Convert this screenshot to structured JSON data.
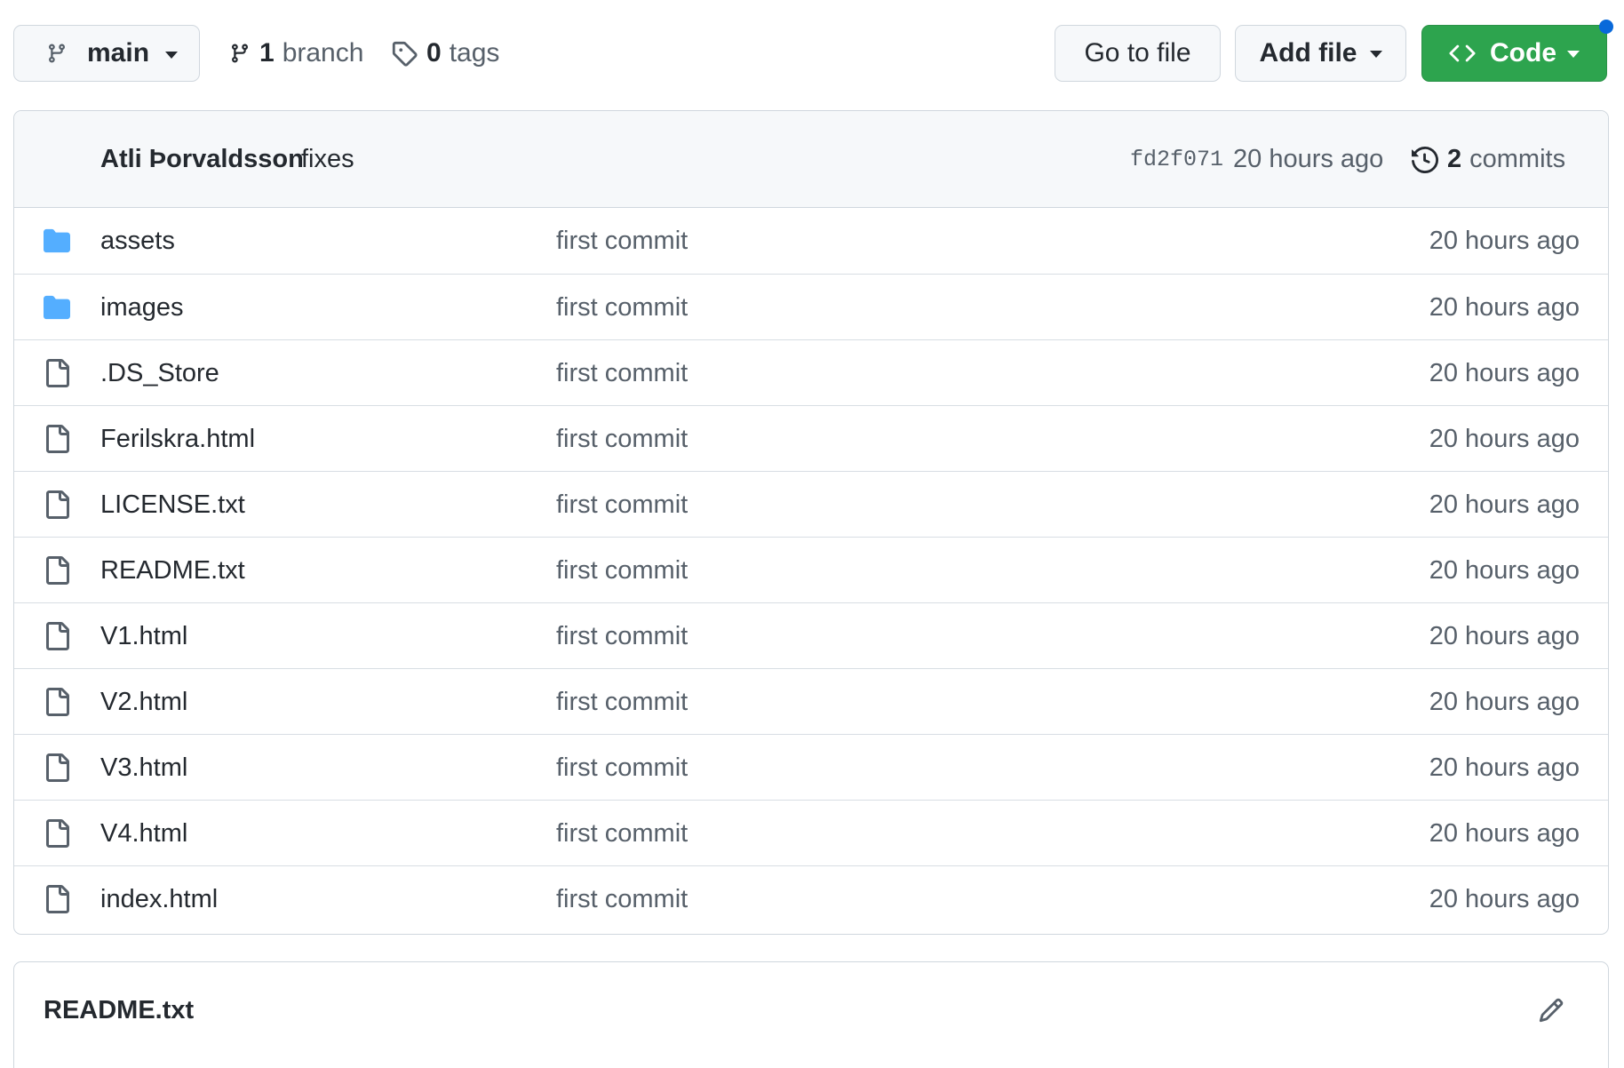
{
  "toolbar": {
    "branch_button": {
      "label": "main",
      "icon": "git-branch-icon"
    },
    "branches": {
      "count": "1",
      "label": "branch",
      "icon": "git-branch-icon"
    },
    "tags": {
      "count": "0",
      "label": "tags",
      "icon": "tag-icon"
    },
    "go_to_file": "Go to file",
    "add_file": "Add file",
    "code": {
      "label": "Code",
      "icon": "code-icon"
    },
    "colors": {
      "code_button": "#2da44e",
      "notification_dot": "#0969da"
    }
  },
  "latest_commit": {
    "author": "Atli Þorvaldsson",
    "message": "fixes",
    "sha": "fd2f071",
    "time": "20 hours ago",
    "commits_count": "2",
    "commits_label": "commits",
    "icon": "history-icon"
  },
  "files": [
    {
      "type": "folder",
      "icon": "folder-icon",
      "name": "assets",
      "message": "first commit",
      "time": "20 hours ago"
    },
    {
      "type": "folder",
      "icon": "folder-icon",
      "name": "images",
      "message": "first commit",
      "time": "20 hours ago"
    },
    {
      "type": "file",
      "icon": "file-icon",
      "name": ".DS_Store",
      "message": "first commit",
      "time": "20 hours ago"
    },
    {
      "type": "file",
      "icon": "file-icon",
      "name": "Ferilskra.html",
      "message": "first commit",
      "time": "20 hours ago"
    },
    {
      "type": "file",
      "icon": "file-icon",
      "name": "LICENSE.txt",
      "message": "first commit",
      "time": "20 hours ago"
    },
    {
      "type": "file",
      "icon": "file-icon",
      "name": "README.txt",
      "message": "first commit",
      "time": "20 hours ago"
    },
    {
      "type": "file",
      "icon": "file-icon",
      "name": "V1.html",
      "message": "first commit",
      "time": "20 hours ago"
    },
    {
      "type": "file",
      "icon": "file-icon",
      "name": "V2.html",
      "message": "first commit",
      "time": "20 hours ago"
    },
    {
      "type": "file",
      "icon": "file-icon",
      "name": "V3.html",
      "message": "first commit",
      "time": "20 hours ago"
    },
    {
      "type": "file",
      "icon": "file-icon",
      "name": "V4.html",
      "message": "first commit",
      "time": "20 hours ago"
    },
    {
      "type": "file",
      "icon": "file-icon",
      "name": "index.html",
      "message": "first commit",
      "time": "20 hours ago"
    }
  ],
  "readme": {
    "title": "README.txt",
    "edit_icon": "pencil-icon"
  }
}
